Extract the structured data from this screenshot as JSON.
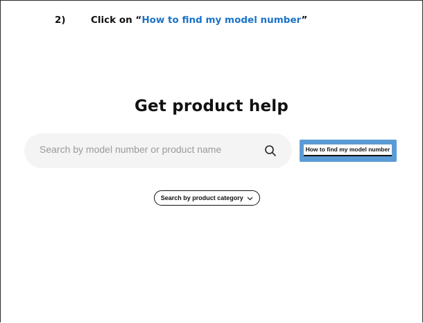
{
  "instruction": {
    "step_number": "2)",
    "prefix": "Click on “",
    "link_text": "How to find my model number",
    "suffix": "”",
    "link_color": "#1a73c8"
  },
  "main": {
    "title": "Get product help",
    "search": {
      "placeholder": "Search by model number or product name",
      "icon": "search-icon"
    },
    "model_number_button": {
      "label": "How to find my model number",
      "highlight_color": "#5b9bd5"
    },
    "category_button": {
      "label": "Search by product category",
      "icon": "chevron-down-icon"
    }
  }
}
